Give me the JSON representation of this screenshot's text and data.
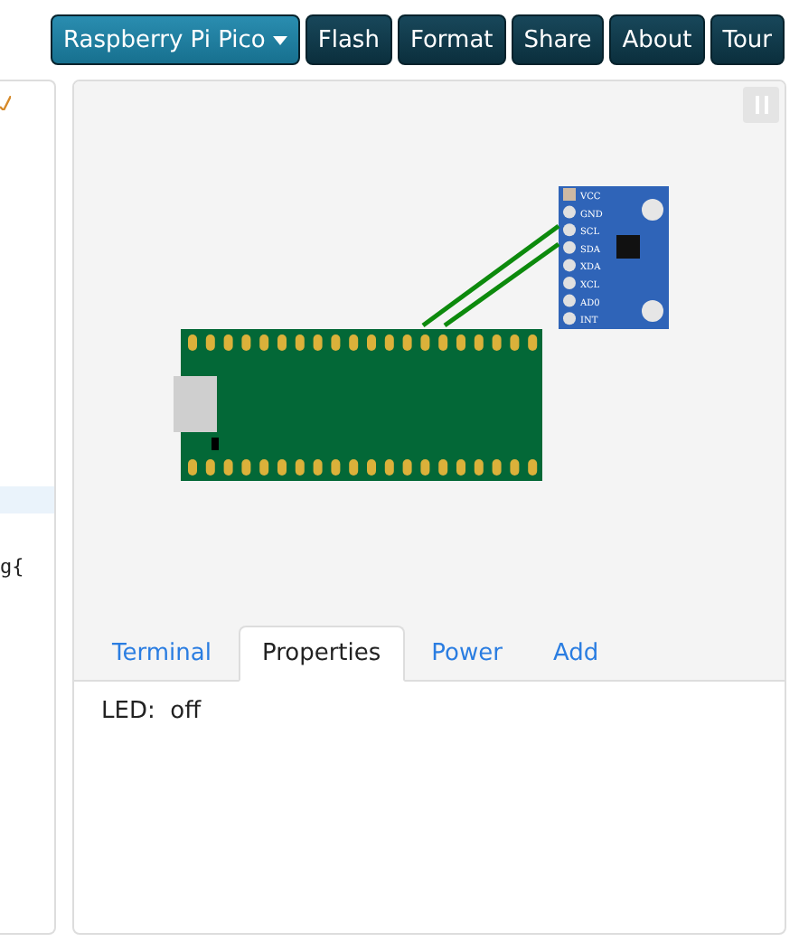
{
  "toolbar": {
    "board_menu": {
      "label": "Raspberry Pi Pico"
    },
    "buttons": [
      "Flash",
      "Format",
      "Share",
      "About",
      "Tour"
    ]
  },
  "editor": {
    "visible_text": "g{"
  },
  "simulator": {
    "module_pins": [
      "VCC",
      "GND",
      "SCL",
      "SDA",
      "XDA",
      "XCL",
      "AD0",
      "INT"
    ],
    "tabs": [
      {
        "label": "Terminal",
        "selected": false
      },
      {
        "label": "Properties",
        "selected": true
      },
      {
        "label": "Power",
        "selected": false
      },
      {
        "label": "Add",
        "selected": false
      }
    ],
    "properties": [
      {
        "name": "LED:",
        "value": "off"
      }
    ]
  }
}
